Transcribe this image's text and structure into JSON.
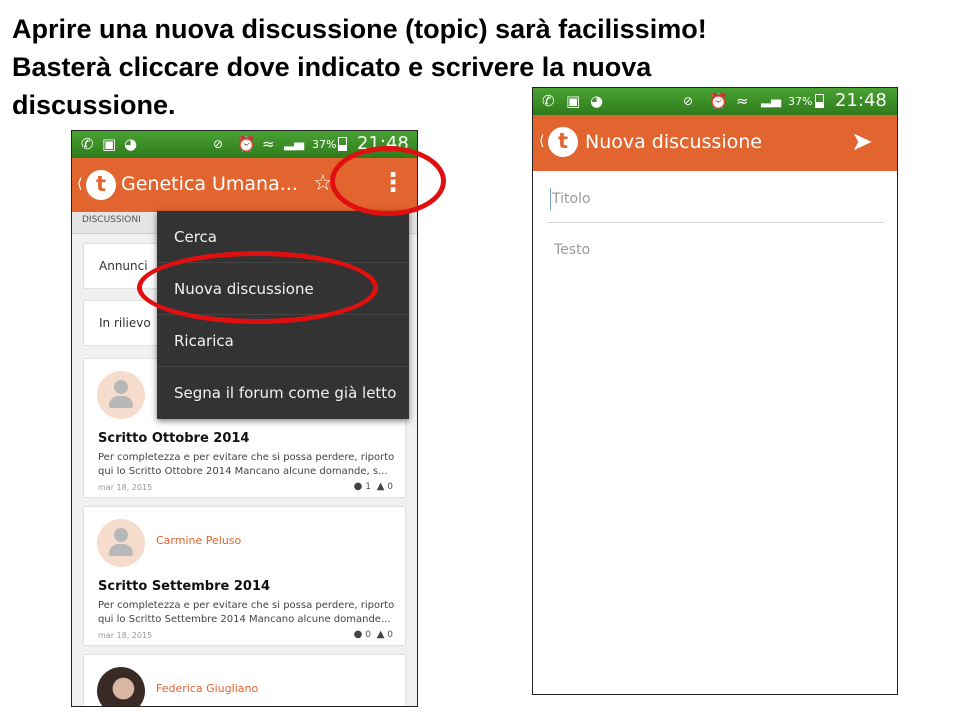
{
  "heading": {
    "line1": "Aprire una nuova discussione (topic) sarà facilissimo!",
    "line2": "Basterà cliccare dove indicato e scrivere la nuova",
    "line3": "discussione."
  },
  "status": {
    "battery": "37%",
    "time_left": "21:48",
    "time_right": "21:48"
  },
  "left_phone": {
    "appbar_title": "Genetica Umana...",
    "logo_letter": "t",
    "tab_label": "DISCUSSIONI",
    "annunci": "Annunci",
    "in_rilievo": "In rilievo",
    "menu": [
      "Cerca",
      "Nuova discussione",
      "Ricarica",
      "Segna il forum come già letto"
    ],
    "posts": [
      {
        "author": "",
        "title": "Scritto Ottobre 2014",
        "excerpt": "Per completezza e per evitare che si possa perdere, riporto qui lo Scritto Ottobre 2014 Mancano alcune domande, s...",
        "date": "mar 18, 2015",
        "comments": "1",
        "likes": "0"
      },
      {
        "author": "Carmine Peluso",
        "title": "Scritto Settembre 2014",
        "excerpt": "Per completezza e per evitare che si possa perdere, riporto qui lo Scritto Settembre 2014 Mancano alcune domande...",
        "date": "mar 18, 2015",
        "comments": "0",
        "likes": "0"
      },
      {
        "author": "Federica Giugliano"
      }
    ]
  },
  "right_phone": {
    "appbar_title": "Nuova discussione",
    "logo_letter": "t",
    "title_placeholder": "Titolo",
    "body_placeholder": "Testo"
  },
  "colors": {
    "accent": "#e2642f",
    "statusbar": "#3b8f27",
    "highlight_ring": "#e01010",
    "menu_bg": "#333333"
  }
}
